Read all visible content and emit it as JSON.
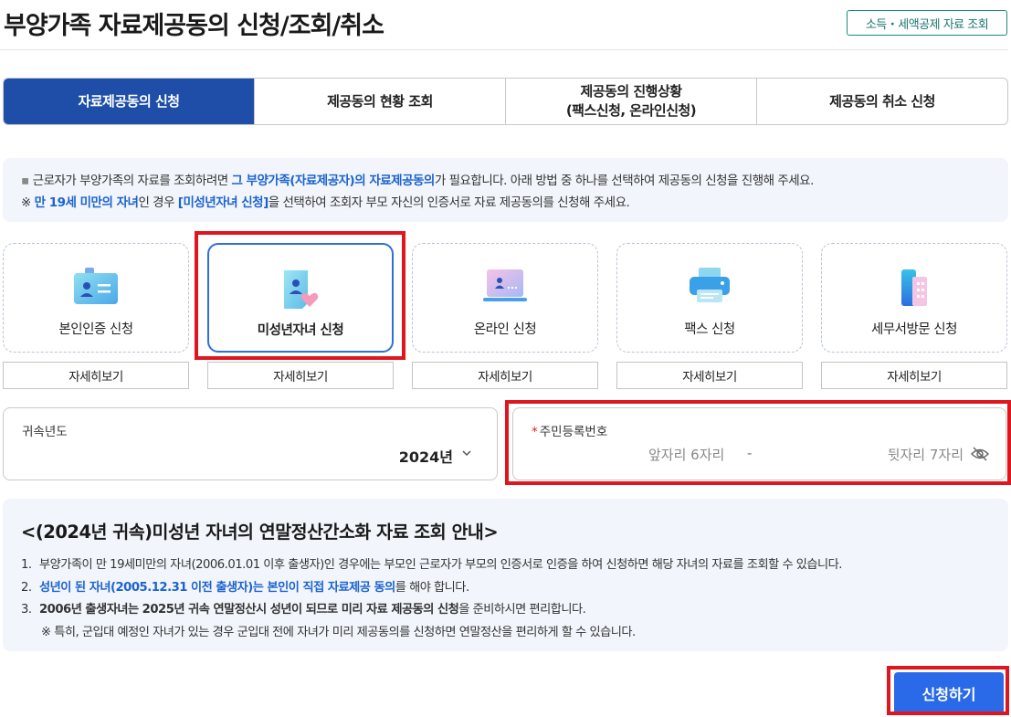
{
  "header": {
    "title": "부양가족 자료제공동의 신청/조회/취소",
    "deduction_link": "소득・세액공제 자료 조회"
  },
  "tabs": [
    {
      "label": "자료제공동의 신청",
      "active": true
    },
    {
      "label": "제공동의 현황 조회",
      "active": false
    },
    {
      "label": "제공동의 진행상황\n(팩스신청, 온라인신청)",
      "active": false
    },
    {
      "label": "제공동의 취소 신청",
      "active": false
    }
  ],
  "notice": {
    "line1_a": "근로자가 부양가족의 자료를 조회하려면 ",
    "line1_b": "그 부양가족(자료제공자)의 자료제공동의",
    "line1_c": "가 필요합니다. 아래 방법 중 하나를 선택하여 제공동의 신청을 진행해 주세요.",
    "line2_a": "※ ",
    "line2_b": "만 19세 미만의 자녀",
    "line2_c": "인 경우 ",
    "line2_d": "[미성년자녀 신청]",
    "line2_e": "을 선택하여 조회자 부모 자신의 인증서로 자료 제공동의를 신청해 주세요."
  },
  "methods": [
    {
      "label": "본인인증 신청",
      "detail": "자세히보기",
      "icon": "id-card-icon",
      "selected": false
    },
    {
      "label": "미성년자녀 신청",
      "detail": "자세히보기",
      "icon": "child-document-icon",
      "selected": true
    },
    {
      "label": "온라인 신청",
      "detail": "자세히보기",
      "icon": "laptop-icon",
      "selected": false
    },
    {
      "label": "팩스 신청",
      "detail": "자세히보기",
      "icon": "fax-printer-icon",
      "selected": false
    },
    {
      "label": "세무서방문 신청",
      "detail": "자세히보기",
      "icon": "building-icon",
      "selected": false
    }
  ],
  "year_field": {
    "label": "귀속년도",
    "value": "2024년"
  },
  "ssn_field": {
    "required_mark": "*",
    "label": "주민등록번호",
    "front_placeholder": "앞자리 6자리",
    "separator": "-",
    "back_placeholder": "뒷자리 7자리"
  },
  "guide": {
    "title": "<(2024년 귀속)미성년 자녀의 연말정산간소화 자료 조회 안내>",
    "item1_num": "1.",
    "item1": "부양가족이 만 19세미만의 자녀(2006.01.01 이후 출생자)인 경우에는 부모인 근로자가 부모의 인증서로 인증을 하여 신청하면 해당 자녀의 자료를 조회할 수 있습니다.",
    "item2_num": "2.",
    "item2_a": "성년이 된 자녀(2005.12.31 이전 출생자)는 본인이 직접 자료제공 동의",
    "item2_b": "를 해야 합니다.",
    "item3_num": "3.",
    "item3_a": "2006년 출생자녀는 2025년 귀속 연말정산시 성년이 되므로 미리 자료 제공동의 신청",
    "item3_b": "을 준비하시면 편리합니다.",
    "note": "※ 특히, 군입대 예정인 자녀가 있는 경우 군입대 전에 자녀가 미리 제공동의를 신청하면 연말정산을 편리하게 할 수 있습니다."
  },
  "actions": {
    "submit": "신청하기"
  },
  "colors": {
    "primary": "#1e4ea8",
    "accent_blue": "#1c63d1",
    "highlight_red": "#e0161e",
    "submit_blue": "#2a6ae8"
  }
}
